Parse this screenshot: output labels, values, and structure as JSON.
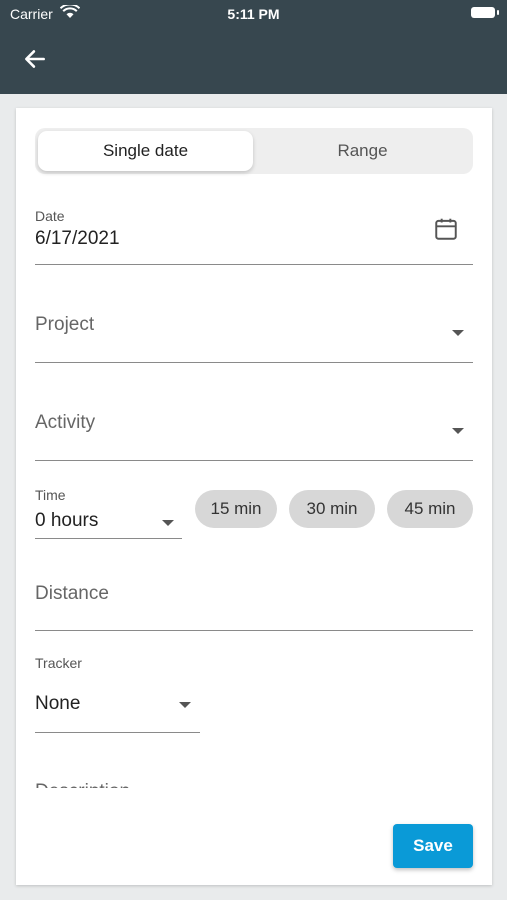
{
  "status": {
    "carrier": "Carrier",
    "time": "5:11 PM"
  },
  "segment": {
    "single": "Single date",
    "range": "Range"
  },
  "date": {
    "label": "Date",
    "value": "6/17/2021"
  },
  "project": {
    "placeholder": "Project"
  },
  "activity": {
    "placeholder": "Activity"
  },
  "time": {
    "label": "Time",
    "value": "0 hours",
    "chips": [
      "15 min",
      "30 min",
      "45 min"
    ]
  },
  "distance": {
    "placeholder": "Distance"
  },
  "tracker": {
    "label": "Tracker",
    "value": "None"
  },
  "description": {
    "placeholder": "Description"
  },
  "save_label": "Save",
  "colors": {
    "appbar": "#37474f",
    "accent": "#0a9ad7"
  }
}
